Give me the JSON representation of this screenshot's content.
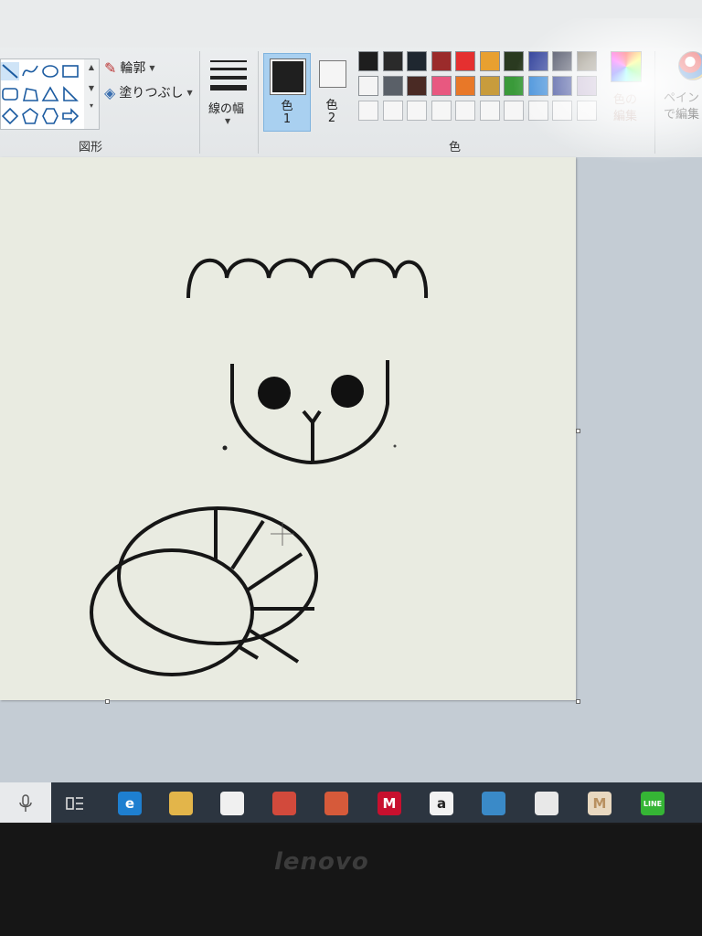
{
  "ribbon": {
    "groups": {
      "shapes": "図形",
      "color": "色"
    },
    "outline_label": "輪郭",
    "fill_label": "塗りつぶし",
    "line_width_label": "線の幅",
    "color1": {
      "label_line1": "色",
      "label_line2": "1",
      "value": "#1f1f1f"
    },
    "color2": {
      "label_line1": "色",
      "label_line2": "2",
      "value": "#f5f5f5"
    },
    "edit_colors": {
      "line1": "色の",
      "line2": "編集"
    },
    "paint3d": {
      "line1": "ペイント",
      "line2": "で編集"
    },
    "palette_row1": [
      "#1e1e1e",
      "#2a2a2a",
      "#1f2730",
      "#9b2b2b",
      "#e53030",
      "#e8a030",
      "#2a3a20",
      "#2e3f9a",
      "#3a3f55",
      "#7a7260"
    ],
    "palette_row2": [
      "#f4f4f4",
      "#5a6068",
      "#4a2a24",
      "#e85880",
      "#e87828",
      "#c89c3c",
      "#3a9a3a",
      "#3a8ad8",
      "#2a3a90",
      "#b8a8c8"
    ],
    "palette_row3_count": 10
  },
  "taskbar": {
    "items": [
      {
        "name": "task-view",
        "icon": "task-view-icon",
        "color": "#2c3540"
      },
      {
        "name": "edge",
        "icon": "edge-icon",
        "label": "e",
        "color": "#1e7fd0"
      },
      {
        "name": "file-explorer",
        "icon": "folder-icon",
        "color": "#e3b54a"
      },
      {
        "name": "store",
        "icon": "store-icon",
        "color": "#f0f0f0"
      },
      {
        "name": "reader",
        "icon": "book-icon",
        "color": "#d24a3c"
      },
      {
        "name": "app-red",
        "icon": "document-icon",
        "color": "#d65a3a"
      },
      {
        "name": "mcafee",
        "icon": "shield-icon",
        "label": "M",
        "color": "#c8102e"
      },
      {
        "name": "amazon",
        "icon": "amazon-icon",
        "label": "a",
        "color": "#f2f2f2"
      },
      {
        "name": "app-blue",
        "icon": "paint-icon",
        "color": "#3a8ac8"
      },
      {
        "name": "mail",
        "icon": "mail-icon",
        "color": "#e8e8e8"
      },
      {
        "name": "paint",
        "icon": "paint-canvas-icon",
        "label": "M",
        "color": "#e8d8c0"
      },
      {
        "name": "line",
        "icon": "chat-icon",
        "label": "LINE",
        "color": "#35b535"
      }
    ]
  },
  "laptop_brand": "lenovo"
}
